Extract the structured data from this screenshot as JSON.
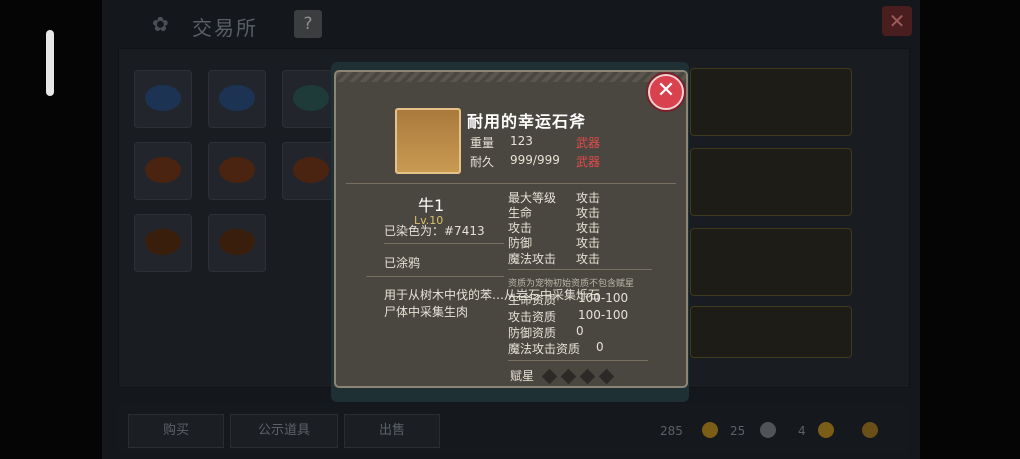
{
  "background": {
    "title": "交易所",
    "title_icon": "gear-flower-icon",
    "help_label": "?",
    "close_label": "✕",
    "buttons": [
      "购买",
      "公示道具",
      "出售"
    ],
    "stats": [
      "285",
      "25",
      "4"
    ]
  },
  "modal": {
    "close_label": "✕",
    "item": {
      "name": "耐用的幸运石斧",
      "weight_label": "重量",
      "weight_value": "123",
      "weight_tag": "武器",
      "durability_label": "耐久",
      "durability_value": "999/999",
      "durability_tag": "武器"
    },
    "pet": {
      "name": "牛1",
      "level": "Lv.10",
      "dyed": "已染色为：#7413",
      "painted": "已涂鸦",
      "description_line1": "用于从树木中伐的苯…从岩石中采集烁石",
      "description_line2": "尸体中采集生肉"
    },
    "attributes": [
      {
        "label": "最大等级",
        "value": "攻击"
      },
      {
        "label": "生命",
        "value": "攻击"
      },
      {
        "label": "攻击",
        "value": "攻击"
      },
      {
        "label": "防御",
        "value": "攻击"
      },
      {
        "label": "魔法攻击",
        "value": "攻击"
      }
    ],
    "aptitude_note": "资质为宠物初始资质不包含赋星",
    "aptitudes": [
      {
        "label": "生命资质",
        "value": "100-100"
      },
      {
        "label": "攻击资质",
        "value": "100-100"
      },
      {
        "label": "防御资质",
        "value": "0"
      },
      {
        "label": "魔法攻击资质",
        "value": "0"
      }
    ],
    "star_label": "赋星",
    "stars": 0,
    "stars_max": 4
  }
}
